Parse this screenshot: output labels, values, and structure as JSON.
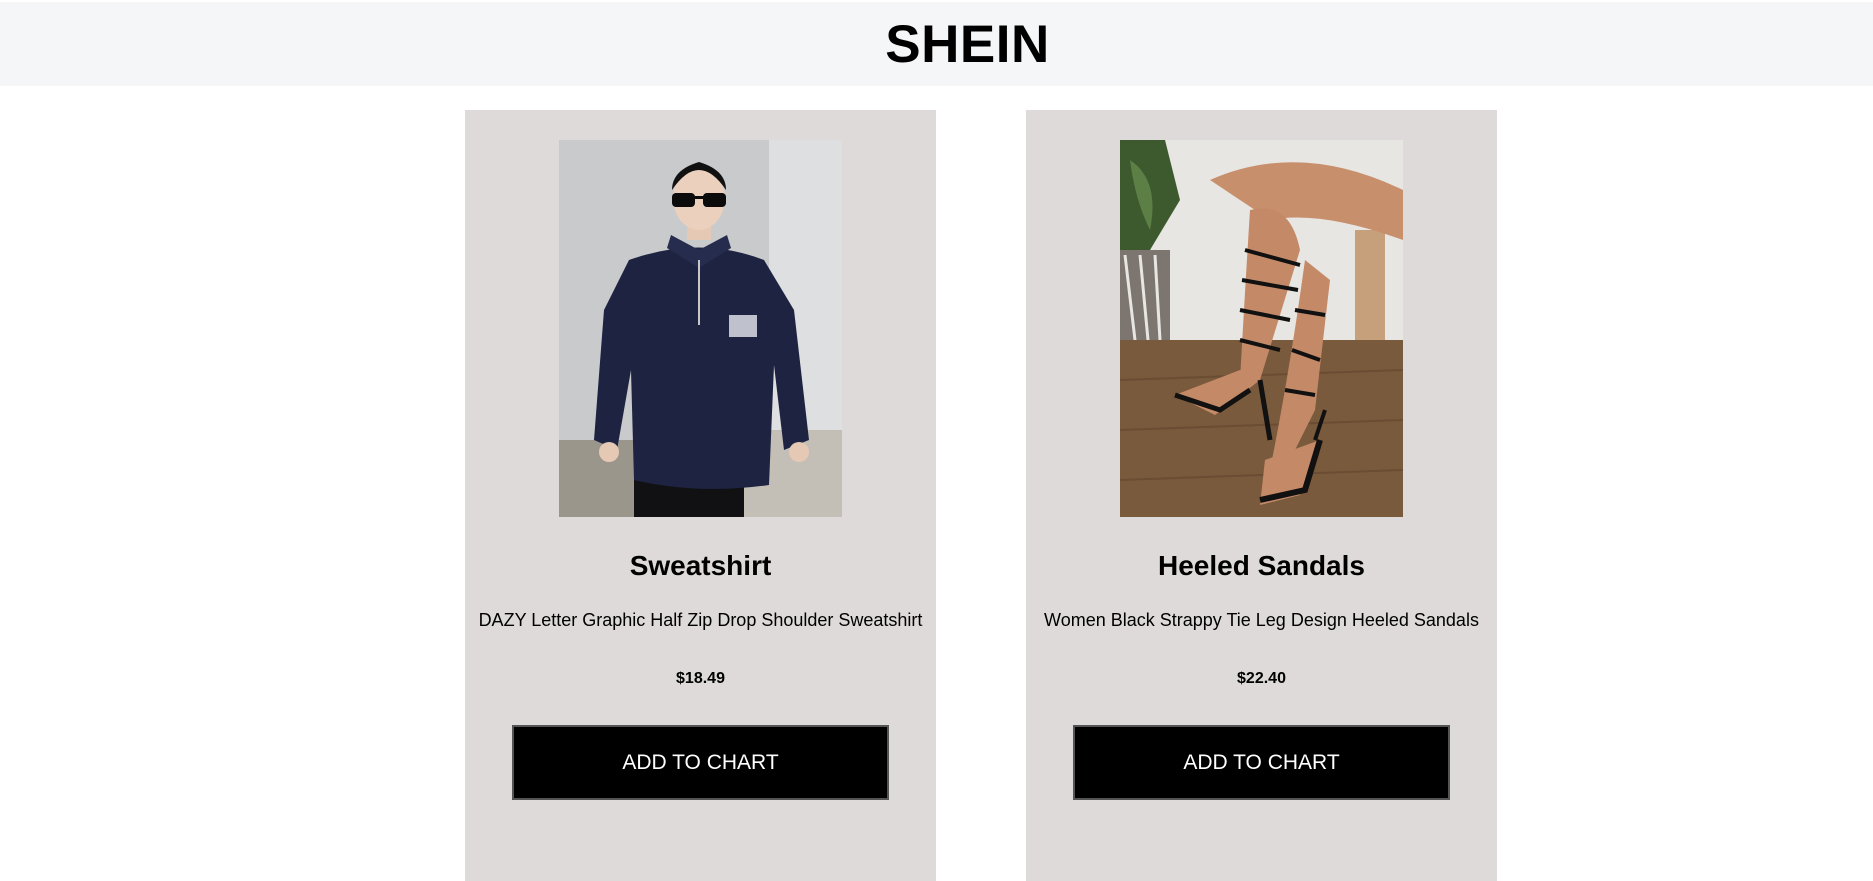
{
  "header": {
    "brand": "SHEIN"
  },
  "products": [
    {
      "title": "Sweatshirt",
      "description": "DAZY Letter Graphic Half Zip Drop Shoulder Sweatshirt",
      "price": "$18.49",
      "button_label": "ADD TO CHART",
      "image_alt": "woman-in-navy-sweatshirt-photo"
    },
    {
      "title": "Heeled Sandals",
      "description": "Women Black Strappy Tie Leg Design Heeled Sandals",
      "price": "$22.40",
      "button_label": "ADD TO CHART",
      "image_alt": "black-strappy-heeled-sandals-photo"
    }
  ],
  "colors": {
    "header_bg": "#f5f6f8",
    "card_bg": "#dfdada",
    "button_bg": "#000000",
    "button_text": "#ffffff"
  }
}
